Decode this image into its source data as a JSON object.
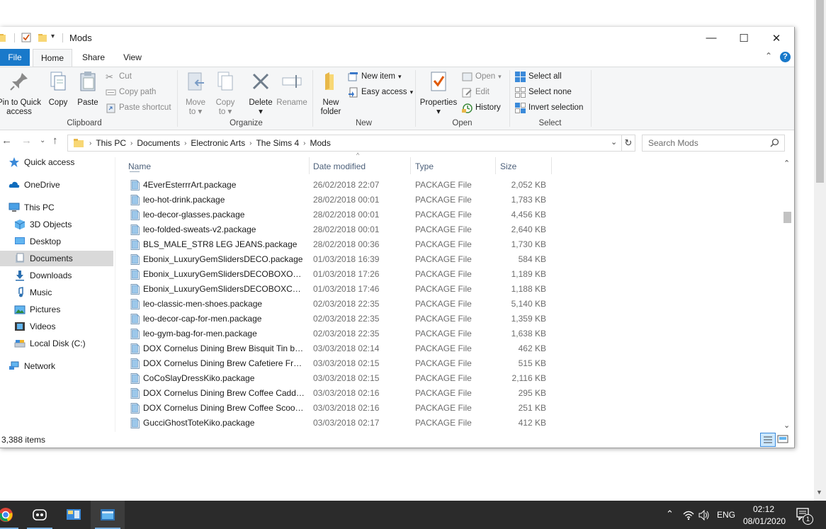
{
  "window": {
    "title": "Mods",
    "controls": {
      "minimize": "—",
      "maximize": "☐",
      "close": "✕"
    }
  },
  "tabs": [
    {
      "label": "File"
    },
    {
      "label": "Home"
    },
    {
      "label": "Share"
    },
    {
      "label": "View"
    }
  ],
  "ribbon": {
    "clipboard": {
      "label": "Clipboard",
      "pin_label_1": "Pin to Quick",
      "pin_label_2": "access",
      "copy": "Copy",
      "paste": "Paste",
      "cut": "Cut",
      "copy_path": "Copy path",
      "paste_shortcut": "Paste shortcut"
    },
    "organize": {
      "label": "Organize",
      "move_to_1": "Move",
      "move_to_2": "to",
      "copy_to_1": "Copy",
      "copy_to_2": "to",
      "delete": "Delete",
      "rename": "Rename"
    },
    "new": {
      "label": "New",
      "new_folder_1": "New",
      "new_folder_2": "folder",
      "new_item": "New item",
      "easy_access": "Easy access"
    },
    "open": {
      "label": "Open",
      "properties": "Properties",
      "open": "Open",
      "edit": "Edit",
      "history": "History"
    },
    "select": {
      "label": "Select",
      "select_all": "Select all",
      "select_none": "Select none",
      "invert": "Invert selection"
    }
  },
  "address": {
    "crumbs": [
      "This PC",
      "Documents",
      "Electronic Arts",
      "The Sims 4",
      "Mods"
    ],
    "search_placeholder": "Search Mods"
  },
  "nav": {
    "items": [
      {
        "label": "Quick access",
        "icon": "star-icon"
      },
      {
        "label": "OneDrive",
        "icon": "cloud-icon"
      },
      {
        "label": "This PC",
        "icon": "computer-icon"
      },
      {
        "label": "3D Objects",
        "icon": "cube-icon"
      },
      {
        "label": "Desktop",
        "icon": "desktop-icon"
      },
      {
        "label": "Documents",
        "icon": "documents-icon"
      },
      {
        "label": "Downloads",
        "icon": "download-icon"
      },
      {
        "label": "Music",
        "icon": "music-icon"
      },
      {
        "label": "Pictures",
        "icon": "pictures-icon"
      },
      {
        "label": "Videos",
        "icon": "videos-icon"
      },
      {
        "label": "Local Disk (C:)",
        "icon": "disk-icon"
      },
      {
        "label": "Network",
        "icon": "network-icon"
      }
    ]
  },
  "columns": {
    "name": "Name",
    "date": "Date modified",
    "type": "Type",
    "size": "Size"
  },
  "files": [
    {
      "name": "4EverEsterrrArt.package",
      "date": "26/02/2018 22:07",
      "type": "PACKAGE File",
      "size": "2,052 KB"
    },
    {
      "name": "leo-hot-drink.package",
      "date": "28/02/2018 00:01",
      "type": "PACKAGE File",
      "size": "1,783 KB"
    },
    {
      "name": "leo-decor-glasses.package",
      "date": "28/02/2018 00:01",
      "type": "PACKAGE File",
      "size": "4,456 KB"
    },
    {
      "name": "leo-folded-sweats-v2.package",
      "date": "28/02/2018 00:01",
      "type": "PACKAGE File",
      "size": "2,640 KB"
    },
    {
      "name": "BLS_MALE_STR8 LEG JEANS.package",
      "date": "28/02/2018 00:36",
      "type": "PACKAGE File",
      "size": "1,730 KB"
    },
    {
      "name": "Ebonix_LuxuryGemSlidersDECO.package",
      "date": "01/03/2018 16:39",
      "type": "PACKAGE File",
      "size": "584 KB"
    },
    {
      "name": "Ebonix_LuxuryGemSlidersDECOBOXOPE...",
      "date": "01/03/2018 17:26",
      "type": "PACKAGE File",
      "size": "1,189 KB"
    },
    {
      "name": "Ebonix_LuxuryGemSlidersDECOBOXCLO...",
      "date": "01/03/2018 17:46",
      "type": "PACKAGE File",
      "size": "1,188 KB"
    },
    {
      "name": "leo-classic-men-shoes.package",
      "date": "02/03/2018 22:35",
      "type": "PACKAGE File",
      "size": "5,140 KB"
    },
    {
      "name": "leo-decor-cap-for-men.package",
      "date": "02/03/2018 22:35",
      "type": "PACKAGE File",
      "size": "1,359 KB"
    },
    {
      "name": "leo-gym-bag-for-men.package",
      "date": "02/03/2018 22:35",
      "type": "PACKAGE File",
      "size": "1,638 KB"
    },
    {
      "name": "DOX Cornelus Dining Brew Bisquit Tin by...",
      "date": "03/03/2018 02:14",
      "type": "PACKAGE File",
      "size": "462 KB"
    },
    {
      "name": "DOX Cornelus Dining Brew Cafetiere Fren...",
      "date": "03/03/2018 02:15",
      "type": "PACKAGE File",
      "size": "515 KB"
    },
    {
      "name": "CoCoSlayDressKiko.package",
      "date": "03/03/2018 02:15",
      "type": "PACKAGE File",
      "size": "2,116 KB"
    },
    {
      "name": "DOX Cornelus Dining Brew Coffee Caddy...",
      "date": "03/03/2018 02:16",
      "type": "PACKAGE File",
      "size": "295 KB"
    },
    {
      "name": "DOX Cornelus Dining Brew Coffee Scoop...",
      "date": "03/03/2018 02:16",
      "type": "PACKAGE File",
      "size": "251 KB"
    },
    {
      "name": "GucciGhostToteKiko.package",
      "date": "03/03/2018 02:17",
      "type": "PACKAGE File",
      "size": "412 KB"
    }
  ],
  "status": {
    "items": "3,388 items"
  },
  "taskbar": {
    "lang": "ENG",
    "time": "02:12",
    "date": "08/01/2020",
    "notification_count": "1"
  }
}
